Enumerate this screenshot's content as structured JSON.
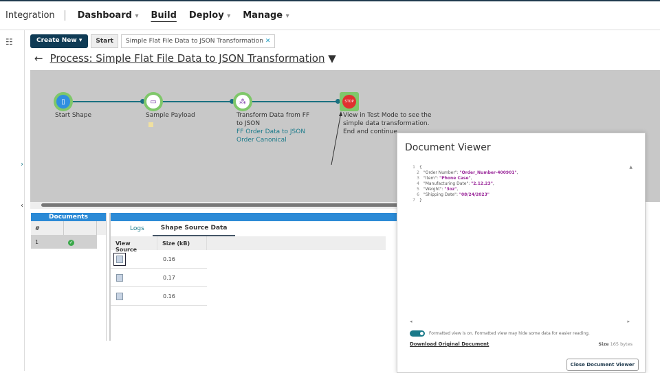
{
  "nav": {
    "brand": "Integration",
    "items": [
      {
        "label": "Dashboard",
        "caret": true
      },
      {
        "label": "Build",
        "caret": false,
        "active": true
      },
      {
        "label": "Deploy",
        "caret": true
      },
      {
        "label": "Manage",
        "caret": true
      }
    ]
  },
  "tabs": {
    "create_new": "Create New",
    "start": "Start",
    "current": "Simple Flat File Data to JSON Transformation"
  },
  "process": {
    "title": "Process: Simple Flat File Data to JSON Transformation"
  },
  "shapes": [
    {
      "label": "Start Shape",
      "sub": "",
      "icon": "start-icon"
    },
    {
      "label": "Sample Payload",
      "sub": "",
      "icon": "message-icon"
    },
    {
      "label": "Transform Data from FF to JSON",
      "sub": "FF Order Data to JSON Order Canonical",
      "icon": "map-icon"
    },
    {
      "label": "View in Test Mode to see the simple data transformation. End and continue",
      "sub": "",
      "icon": "stop-icon"
    }
  ],
  "documents": {
    "title": "Documents",
    "col": "#",
    "rows": [
      {
        "num": "1",
        "status": "success"
      }
    ]
  },
  "details": {
    "tabs": [
      "Logs",
      "Shape Source Data"
    ],
    "active_tab": "Shape Source Data",
    "columns": [
      "View Source",
      "Size (kB)"
    ],
    "rows": [
      {
        "size": "0.16"
      },
      {
        "size": "0.17"
      },
      {
        "size": "0.16"
      }
    ]
  },
  "viewer": {
    "title": "Document Viewer",
    "lines": [
      {
        "n": "1",
        "k": "{",
        "v": "",
        "e": ""
      },
      {
        "n": "2",
        "k": "\"Order Number\": ",
        "v": "\"Order_Number-400901\"",
        "e": ","
      },
      {
        "n": "3",
        "k": "\"Item\": ",
        "v": "\"Phone Case\"",
        "e": ","
      },
      {
        "n": "4",
        "k": "\"Manufacturing Date\": ",
        "v": "\"2.12.23\"",
        "e": ","
      },
      {
        "n": "5",
        "k": "\"Weight\": ",
        "v": "\"3oz\"",
        "e": ","
      },
      {
        "n": "6",
        "k": "\"Shipping Date\": ",
        "v": "\"08/24/2023\"",
        "e": ""
      },
      {
        "n": "7",
        "k": "}",
        "v": "",
        "e": ""
      }
    ],
    "formatted_on": true,
    "formatted_note": "Formatted view is on. Formatted view may hide some data for easier reading.",
    "download": "Download Original Document",
    "size_label": "Size",
    "size_value": "165 bytes",
    "close": "Close Document Viewer"
  }
}
